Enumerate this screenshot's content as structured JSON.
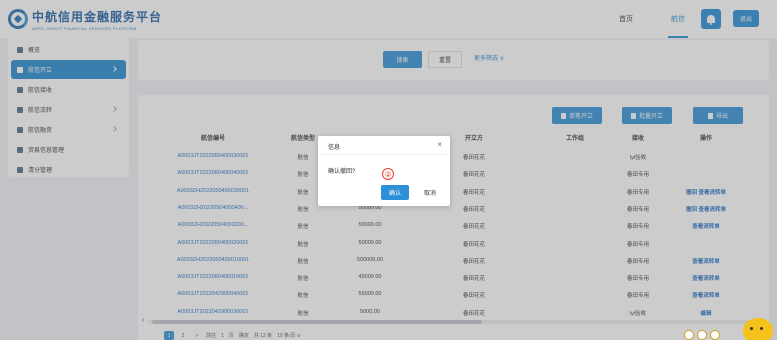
{
  "header": {
    "logo_cn": "中航信用金融服务平台",
    "logo_en": "AERO CREDIT FINANCIAL SERVICES PLATFORM",
    "nav": [
      {
        "label": "首页",
        "active": false
      },
      {
        "label": "航信",
        "active": true
      }
    ],
    "logout_label": "退出"
  },
  "sidebar": {
    "items": [
      {
        "label": "概览",
        "icon": "home-icon",
        "active": false,
        "has_chevron": false
      },
      {
        "label": "航信开立",
        "icon": "issue-icon",
        "active": true,
        "has_chevron": true
      },
      {
        "label": "航信接收",
        "icon": "receive-icon",
        "active": false,
        "has_chevron": false
      },
      {
        "label": "航信流转",
        "icon": "transfer-icon",
        "active": false,
        "has_chevron": true
      },
      {
        "label": "航信融资",
        "icon": "finance-icon",
        "active": false,
        "has_chevron": true
      },
      {
        "label": "贸易信息管理",
        "icon": "trade-icon",
        "active": false,
        "has_chevron": false
      },
      {
        "label": "清分管理",
        "icon": "settle-icon",
        "active": false,
        "has_chevron": false
      }
    ]
  },
  "search": {
    "search_label": "搜索",
    "reset_label": "重置",
    "more_label": "更多筛选 ∨"
  },
  "table": {
    "buttons": {
      "single": "单笔开立",
      "batch": "批量开立",
      "export": "导出"
    },
    "headers": [
      "航信编号",
      "航信类型",
      "开立方",
      "工作组",
      "接收",
      "操作"
    ],
    "rows": [
      {
        "id": "A0003JT2022050400030001",
        "type": "航信",
        "amount": "",
        "issuer": "春田花花",
        "group": "",
        "receiver": "lyl验收",
        "ops": ""
      },
      {
        "id": "A0003JT2022050400040001",
        "type": "航信",
        "amount": "",
        "issuer": "春田花花",
        "group": "",
        "receiver": "春田专用",
        "ops": ""
      },
      {
        "id": "A0003ZH2022050400030001",
        "type": "航信",
        "amount": "",
        "issuer": "春田花花",
        "group": "",
        "receiver": "春田专用",
        "ops": "撤回 查看流转单"
      },
      {
        "id": "A0003ZH20220504000400...",
        "type": "航信",
        "amount": "50000.00",
        "issuer": "春田花花",
        "group": "",
        "receiver": "春田专用",
        "ops": "撤回 查看流转单"
      },
      {
        "id": "A0003ZH20220504000200...",
        "type": "航信",
        "amount": "50000.00",
        "issuer": "春田花花",
        "group": "",
        "receiver": "春田专用",
        "ops": "查看流转单"
      },
      {
        "id": "A0003JT2022050400020001",
        "type": "航信",
        "amount": "50000.00",
        "issuer": "春田花花",
        "group": "",
        "receiver": "春田专用",
        "ops": ""
      },
      {
        "id": "A0003ZH2022050400010001",
        "type": "航信",
        "amount": "500000.00",
        "issuer": "春田花花",
        "group": "",
        "receiver": "春田专用",
        "ops": "查看流转单"
      },
      {
        "id": "A0003JT2022050400010001",
        "type": "航信",
        "amount": "45000.00",
        "issuer": "春田花花",
        "group": "",
        "receiver": "春田专用",
        "ops": "查看流转单"
      },
      {
        "id": "A0003JT2022042900040001",
        "type": "航信",
        "amount": "55000.00",
        "issuer": "春田花花",
        "group": "",
        "receiver": "春田专用",
        "ops": "查看流转单"
      },
      {
        "id": "A0003JT2022042900030001",
        "type": "航信",
        "amount": "5000.00",
        "issuer": "春田花花",
        "group": "",
        "receiver": "lyl验收",
        "ops": "编辑"
      }
    ],
    "pager": {
      "pages": [
        "1",
        "2",
        ">"
      ],
      "goto": "前往",
      "page_num": "1",
      "page_unit": "页",
      "confirm": "确定",
      "total": "共 12 条",
      "page_size": "10 条/页 ∨"
    }
  },
  "modal": {
    "title": "信息",
    "close": "×",
    "message": "确认撤回?",
    "step_marker": "②",
    "ok_label": "确认",
    "cancel_label": "取消"
  }
}
